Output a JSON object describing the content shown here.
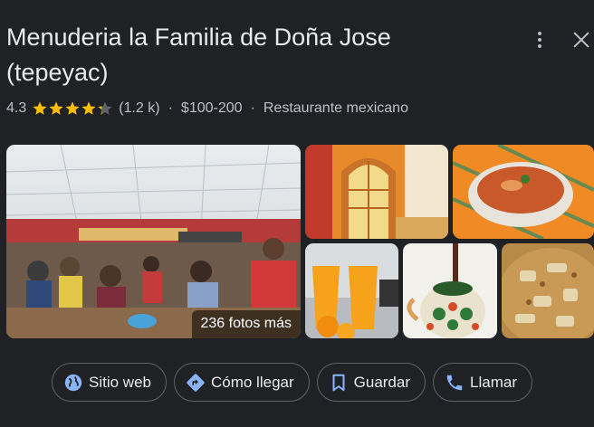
{
  "place": {
    "name": "Menuderia la Familia de Doña Jose (tepeyac)",
    "rating": "4.3",
    "rating_value": 4.3,
    "rating_max": 5,
    "reviews": "(1.2 k)",
    "price": "$100-200",
    "separator": "·",
    "category": "Restaurante mexicano"
  },
  "photos": {
    "more_label": "236 fotos más"
  },
  "actions": [
    {
      "label": "Sitio web",
      "icon": "globe-icon"
    },
    {
      "label": "Cómo llegar",
      "icon": "directions-icon"
    },
    {
      "label": "Guardar",
      "icon": "bookmark-icon"
    },
    {
      "label": "Llamar",
      "icon": "phone-icon"
    }
  ],
  "colors": {
    "background": "#202124",
    "star": "#fbbc04",
    "accent": "#8ab4f8",
    "text": "#e8eaed",
    "secondary_text": "#bdc1c6"
  }
}
